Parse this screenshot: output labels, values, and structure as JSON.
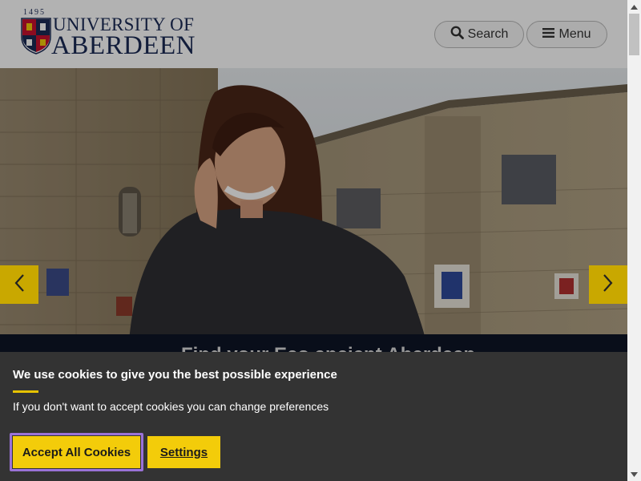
{
  "header": {
    "logo": {
      "year": "1495",
      "line1": "UNIVERSITY OF",
      "line2": "ABERDEEN"
    },
    "search_label": "Search",
    "menu_label": "Menu"
  },
  "hero": {
    "caption_partial": "Find your Eco ancient Aberdeen"
  },
  "cookie_banner": {
    "title": "We use cookies to give you the best possible experience",
    "description": "If you don't want to accept cookies you can change preferences",
    "accept_label": "Accept All Cookies",
    "settings_label": "Settings"
  },
  "colors": {
    "brand_navy": "#1b2a55",
    "accent_yellow": "#f3cc0a",
    "banner_bg": "#333333",
    "focus_ring": "#9a72d8"
  }
}
